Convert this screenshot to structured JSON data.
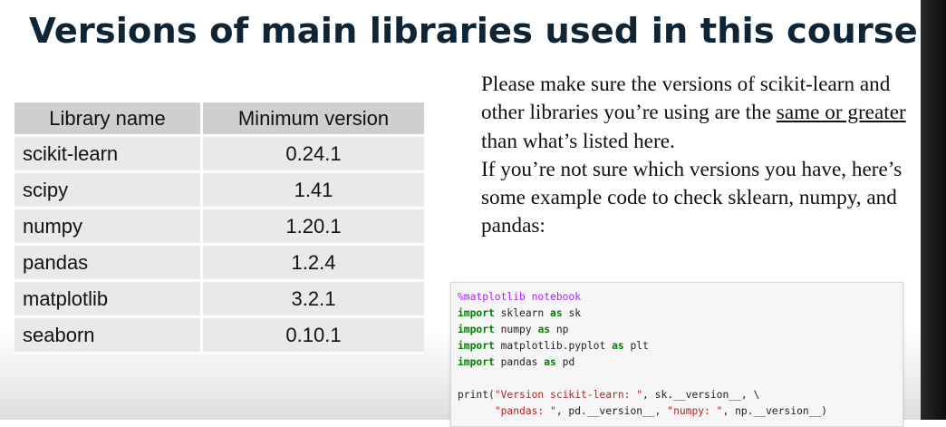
{
  "slide": {
    "title": "Versions of main libraries used in this course"
  },
  "table": {
    "headers": [
      "Library name",
      "Minimum version"
    ],
    "rows": [
      {
        "library": "scikit-learn",
        "version": "0.24.1"
      },
      {
        "library": "scipy",
        "version": "1.41"
      },
      {
        "library": "numpy",
        "version": "1.20.1"
      },
      {
        "library": "pandas",
        "version": "1.2.4"
      },
      {
        "library": "matplotlib",
        "version": "3.2.1"
      },
      {
        "library": "seaborn",
        "version": "0.10.1"
      }
    ]
  },
  "instructions": {
    "para1_before": "Please make sure the versions of scikit-learn and other libraries you’re using are the ",
    "para1_underlined": "same or greater",
    "para1_after": " than what’s listed here.",
    "para2": "If you’re not sure which versions you have, here’s some example code to check sklearn, numpy, and pandas:"
  },
  "code": {
    "magic": "%matplotlib notebook",
    "kw_import": "import",
    "kw_as": "as",
    "imports": [
      {
        "module": "sklearn",
        "alias": "sk"
      },
      {
        "module": "numpy",
        "alias": "np"
      },
      {
        "module": "matplotlib.pyplot",
        "alias": "plt"
      },
      {
        "module": "pandas",
        "alias": "pd"
      }
    ],
    "print_fn": "print(",
    "str_sklearn": "\"Version scikit-learn: \"",
    "attr_sk": ", sk.__version__, \\",
    "line2_indent": "      ",
    "str_pandas": "\"pandas: \"",
    "attr_pd": ", pd.__version__, ",
    "str_numpy": "\"numpy: \"",
    "attr_np": ", np.__version__)"
  },
  "colors": {
    "title": "#0f2536",
    "table_header_bg": "#cfcfcf",
    "table_row_bg": "#e9e9e9",
    "code_bg": "#f6f6f6",
    "code_keyword": "#008000",
    "code_magic": "#aa22ff",
    "code_string": "#ba2121"
  }
}
